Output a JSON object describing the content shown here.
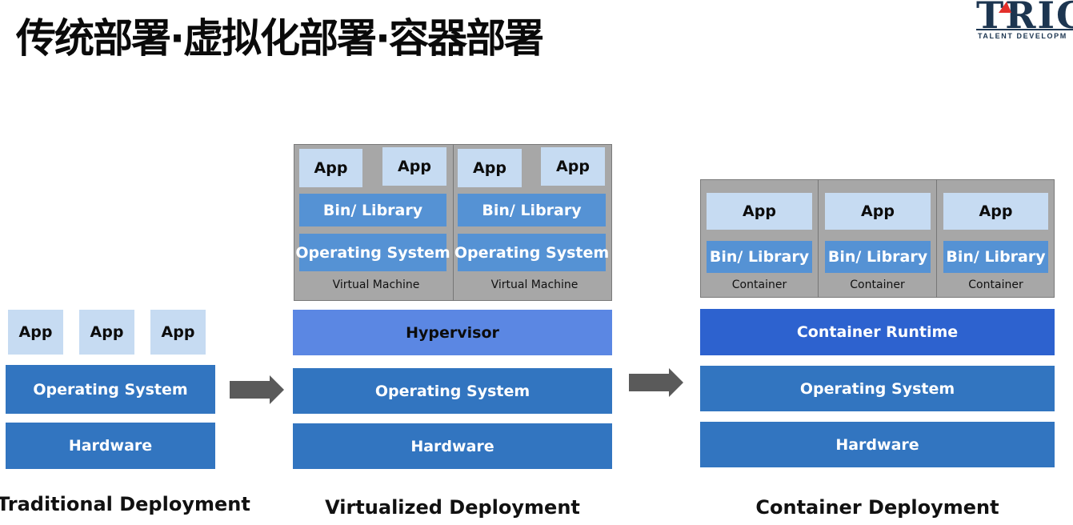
{
  "title": "传统部署·虚拟化部署·容器部署",
  "logo": {
    "word": "TRIC",
    "subtitle": "TALENT DEVELOPM"
  },
  "traditional": {
    "apps": [
      "App",
      "App",
      "App"
    ],
    "os": "Operating System",
    "hardware": "Hardware",
    "label": "Traditional Deployment"
  },
  "virtualized": {
    "vms": [
      {
        "apps": [
          "App",
          "App"
        ],
        "lib": "Bin/ Library",
        "os": "Operating System",
        "caption": "Virtual Machine"
      },
      {
        "apps": [
          "App",
          "App"
        ],
        "lib": "Bin/ Library",
        "os": "Operating System",
        "caption": "Virtual Machine"
      }
    ],
    "hypervisor": "Hypervisor",
    "os": "Operating System",
    "hardware": "Hardware",
    "label": "Virtualized Deployment"
  },
  "container": {
    "containers": [
      {
        "app": "App",
        "lib": "Bin/ Library",
        "caption": "Container"
      },
      {
        "app": "App",
        "lib": "Bin/ Library",
        "caption": "Container"
      },
      {
        "app": "App",
        "lib": "Bin/ Library",
        "caption": "Container"
      }
    ],
    "runtime": "Container Runtime",
    "os": "Operating System",
    "hardware": "Hardware",
    "label": "Container Deployment"
  },
  "colors": {
    "app": "#c6dbf2",
    "os_hardware": "#3275c0",
    "library": "#5592d4",
    "hypervisor": "#5b87e3",
    "runtime": "#2d62cf",
    "panel": "#a7a7a7",
    "arrow": "#5a5a5a",
    "logo_accent": "#e3302b"
  }
}
